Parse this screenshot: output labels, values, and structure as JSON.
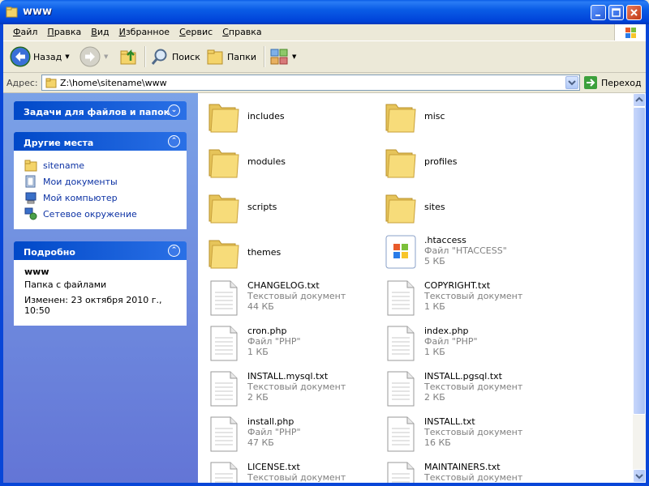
{
  "window": {
    "title": "www"
  },
  "menu": [
    "Файл",
    "Правка",
    "Вид",
    "Избранное",
    "Сервис",
    "Справка"
  ],
  "toolbar": {
    "back_label": "Назад",
    "search_label": "Поиск",
    "folders_label": "Папки"
  },
  "address": {
    "label": "Адрес:",
    "path": "Z:\\home\\sitename\\www",
    "go_label": "Переход"
  },
  "taskpane": {
    "tasks_title": "Задачи для файлов и папок",
    "places_title": "Другие места",
    "places": [
      {
        "label": "sitename",
        "icon": "folder-icon"
      },
      {
        "label": "Мои документы",
        "icon": "my-documents-icon"
      },
      {
        "label": "Мой компьютер",
        "icon": "my-computer-icon"
      },
      {
        "label": "Сетевое окружение",
        "icon": "network-places-icon"
      }
    ],
    "details_title": "Подробно",
    "details": {
      "name": "www",
      "type": "Папка с файлами",
      "modified": "Изменен: 23 октября 2010 г., 10:50"
    }
  },
  "files": [
    {
      "name": "includes",
      "type": "",
      "size": "",
      "icon": "folder"
    },
    {
      "name": "misc",
      "type": "",
      "size": "",
      "icon": "folder"
    },
    {
      "name": "modules",
      "type": "",
      "size": "",
      "icon": "folder"
    },
    {
      "name": "profiles",
      "type": "",
      "size": "",
      "icon": "folder"
    },
    {
      "name": "scripts",
      "type": "",
      "size": "",
      "icon": "folder"
    },
    {
      "name": "sites",
      "type": "",
      "size": "",
      "icon": "folder"
    },
    {
      "name": "themes",
      "type": "",
      "size": "",
      "icon": "folder"
    },
    {
      "name": ".htaccess",
      "type": "Файл \"HTACCESS\"",
      "size": "5 КБ",
      "icon": "windows-file"
    },
    {
      "name": "CHANGELOG.txt",
      "type": "Текстовый документ",
      "size": "44 КБ",
      "icon": "text"
    },
    {
      "name": "COPYRIGHT.txt",
      "type": "Текстовый документ",
      "size": "1 КБ",
      "icon": "text"
    },
    {
      "name": "cron.php",
      "type": "Файл \"PHP\"",
      "size": "1 КБ",
      "icon": "text"
    },
    {
      "name": "index.php",
      "type": "Файл \"PHP\"",
      "size": "1 КБ",
      "icon": "text"
    },
    {
      "name": "INSTALL.mysql.txt",
      "type": "Текстовый документ",
      "size": "2 КБ",
      "icon": "text"
    },
    {
      "name": "INSTALL.pgsql.txt",
      "type": "Текстовый документ",
      "size": "2 КБ",
      "icon": "text"
    },
    {
      "name": "install.php",
      "type": "Файл \"PHP\"",
      "size": "47 КБ",
      "icon": "text"
    },
    {
      "name": "INSTALL.txt",
      "type": "Текстовый документ",
      "size": "16 КБ",
      "icon": "text"
    },
    {
      "name": "LICENSE.txt",
      "type": "Текстовый документ",
      "size": "",
      "icon": "text"
    },
    {
      "name": "MAINTAINERS.txt",
      "type": "Текстовый документ",
      "size": "",
      "icon": "text"
    }
  ]
}
